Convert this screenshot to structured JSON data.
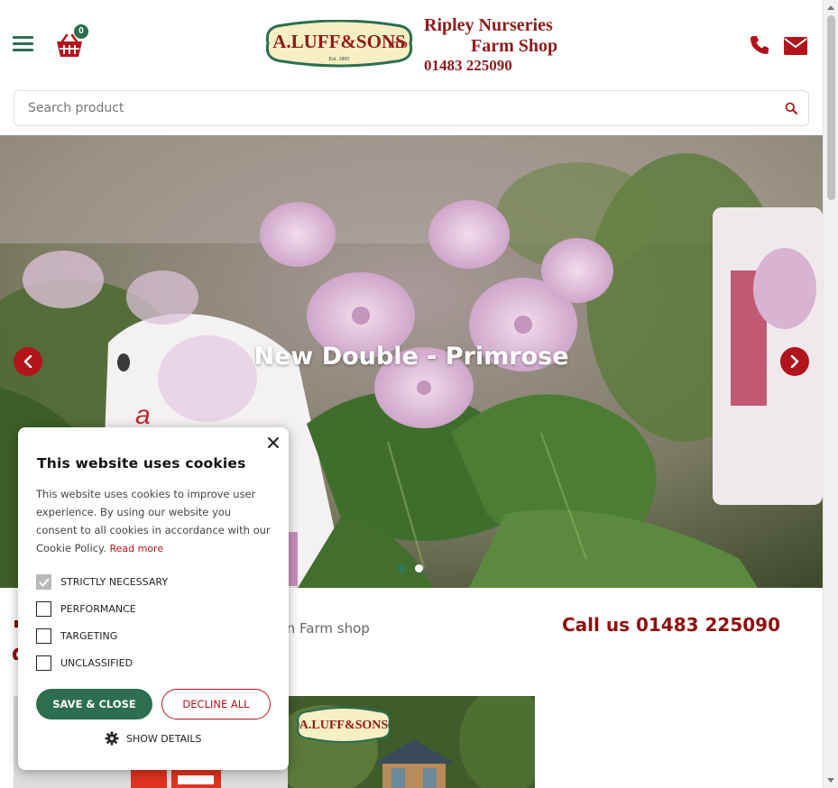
{
  "header": {
    "basket_count": "0",
    "logo_text": "A.LUFF & SONS LTD",
    "logo_est": "Est. 1895",
    "shop_name_line1": "Ripley Nurseries",
    "shop_name_line2": "Farm Shop",
    "shop_phone": "01483 225090"
  },
  "search": {
    "placeholder": "Search product",
    "value": ""
  },
  "hero": {
    "slide_title": "New Double - Primrose",
    "dots": [
      "active",
      "inactive"
    ]
  },
  "content": {
    "news_text": "s in Farm shop",
    "call_us": "Call us 01483 225090"
  },
  "cookie": {
    "title": "This website uses cookies",
    "body": "This website uses cookies to improve user experience. By using our website you consent to all cookies in accordance with our Cookie Policy.",
    "read_more": "Read more",
    "options": [
      {
        "label": "STRICTLY NECESSARY",
        "checked": true
      },
      {
        "label": "PERFORMANCE",
        "checked": false
      },
      {
        "label": "TARGETING",
        "checked": false
      },
      {
        "label": "UNCLASSIFIED",
        "checked": false
      }
    ],
    "save_label": "SAVE & CLOSE",
    "decline_label": "DECLINE ALL",
    "show_details_label": "SHOW DETAILS"
  },
  "colors": {
    "brand_green": "#2d6e50",
    "brand_red": "#b1141b",
    "dark_red": "#8f1a1a"
  },
  "icons": [
    "menu-icon",
    "basket-icon",
    "phone-icon",
    "mail-icon",
    "search-icon",
    "chevron-left-icon",
    "chevron-right-icon",
    "close-icon",
    "gear-icon"
  ]
}
